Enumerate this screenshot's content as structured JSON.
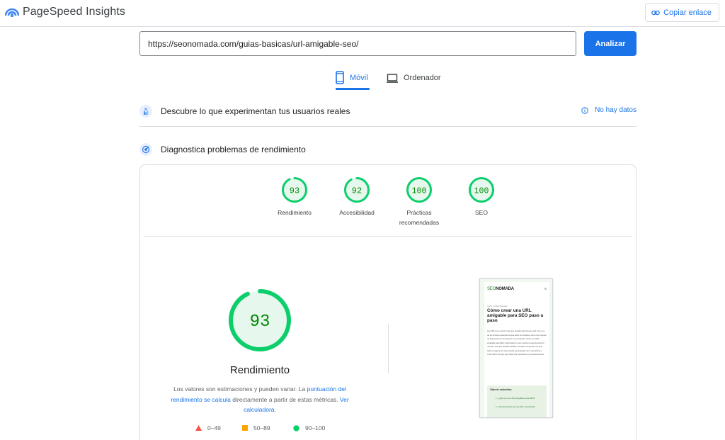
{
  "app": {
    "title": "PageSpeed Insights"
  },
  "header": {
    "copy_link_label": "Copiar enlace"
  },
  "search": {
    "url_value": "https://seonomada.com/guias-basicas/url-amigable-seo/",
    "analyze_label": "Analizar"
  },
  "tabs": [
    {
      "label": "Móvil",
      "active": true
    },
    {
      "label": "Ordenador",
      "active": false
    }
  ],
  "real_users": {
    "title": "Descubre lo que experimentan tus usuarios reales",
    "no_data_label": "No hay datos"
  },
  "diagnostics": {
    "title": "Diagnostica problemas de rendimiento"
  },
  "scores": [
    {
      "value": "93",
      "label": "Rendimiento"
    },
    {
      "value": "92",
      "label": "Accesibilidad"
    },
    {
      "value": "100",
      "label": "Prácticas recomendadas"
    },
    {
      "value": "100",
      "label": "SEO"
    }
  ],
  "performance": {
    "score": "93",
    "title": "Rendimiento",
    "desc_prefix": "Los valores son estimaciones y pueden variar. La ",
    "desc_link1": "puntuación del rendimiento se calcula",
    "desc_middle": " directamente a partir de estas métricas. ",
    "desc_link2": "Ver calculadora",
    "desc_suffix": "."
  },
  "legend": [
    {
      "range": "0–49",
      "color": "#ff4e42"
    },
    {
      "range": "50–89",
      "color": "#ffa400"
    },
    {
      "range": "90–100",
      "color": "#0cce6b"
    }
  ],
  "colors": {
    "accent": "#1a73e8",
    "pass": "#0cce6b",
    "pass_text": "#008800",
    "pass_fill": "#e6f8ee"
  },
  "thumbnail": {
    "logo_prefix": "SEO",
    "logo_suffix": "NOMADA",
    "menu_icon": "≡",
    "breadcrumb": "Inicio / Guías básicas",
    "heading": "Cómo crear una URL amigable para SEO paso a paso",
    "paragraph": "Las URLs son mucho más que simples direcciones web. Son uno de los primeros elementos que tanto los usuarios como los motores de búsqueda ven al acceder a tu contenido. Tener una URL amigable para SEO optimizada no solo mejora la experiencia del usuario, sino que también facilita a Google comprender de qué trata tu página. En este tutorial, aprenderás cómo estructurar y crear URLs friendly para SEO que beneficien tu posicionamiento.",
    "toc_title": "Tabla de contenidos",
    "toc_items": [
      "1. ¿Qué es una URL amigable para SEO?",
      "2. Características de una URL optimizada"
    ]
  }
}
